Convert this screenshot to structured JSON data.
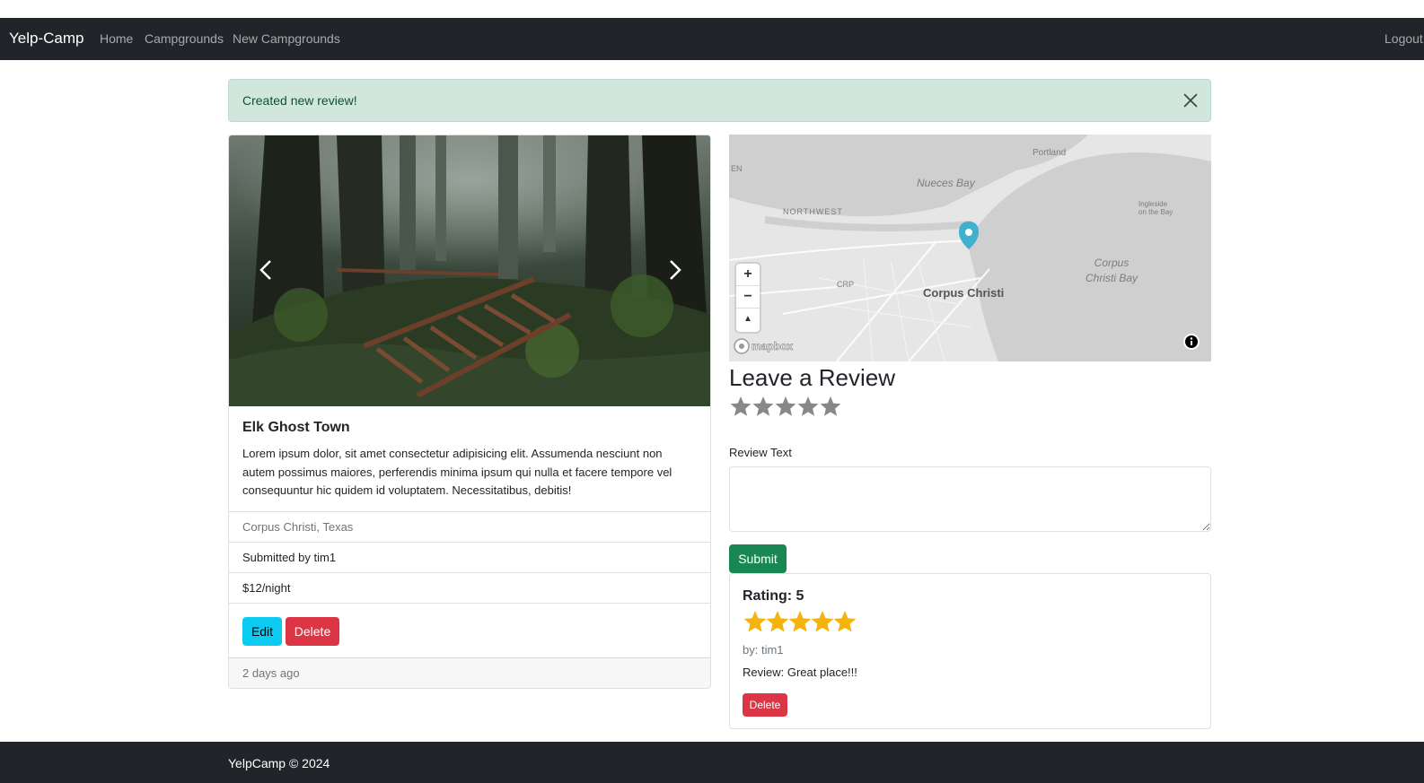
{
  "navbar": {
    "brand": "Yelp-Camp",
    "links": [
      "Home",
      "Campgrounds",
      "New Campgrounds"
    ],
    "logout": "Logout"
  },
  "alert": {
    "message": "Created new review!",
    "color": "#d1e7dd"
  },
  "campground": {
    "title": "Elk Ghost Town",
    "description": "Lorem ipsum dolor, sit amet consectetur adipisicing elit. Assumenda nesciunt non autem possimus maiores, perferendis minima ipsum qui nulla et facere tempore vel consequuntur hic quidem id voluptatem. Necessitatibus, debitis!",
    "location": "Corpus Christi, Texas",
    "submitted_by": "Submitted by tim1",
    "price": "$12/night",
    "edit_label": "Edit",
    "delete_label": "Delete",
    "posted": "2 days ago"
  },
  "map": {
    "labels": {
      "nueces_bay": "Nueces Bay",
      "portland": "Portland",
      "northwest": "NORTHWEST",
      "crp": "CRP",
      "city": "Corpus Christi",
      "bay_line1": "Corpus",
      "bay_line2": "Christi Bay",
      "ingleside_line1": "Ingleside",
      "ingleside_line2": "on the Bay",
      "edge": "EN"
    },
    "zoom_in": "+",
    "zoom_out": "−",
    "compass": "▲",
    "attribution_logo": "mapbox",
    "marker_color": "#3fb1ce"
  },
  "review_form": {
    "heading": "Leave a Review",
    "stars_total": 5,
    "text_label": "Review Text",
    "textarea_value": "",
    "submit_label": "Submit"
  },
  "reviews": [
    {
      "title": "Rating: 5",
      "rating": 5,
      "author": "by: tim1",
      "text": "Review: Great place!!!",
      "delete_label": "Delete"
    }
  ],
  "footer": {
    "text": "YelpCamp © 2024"
  },
  "colors": {
    "navbar": "#212529",
    "star_filled": "#f5b40b",
    "star_empty": "#888888",
    "success": "#198754",
    "danger": "#dc3545",
    "info": "#0dcaf0"
  }
}
